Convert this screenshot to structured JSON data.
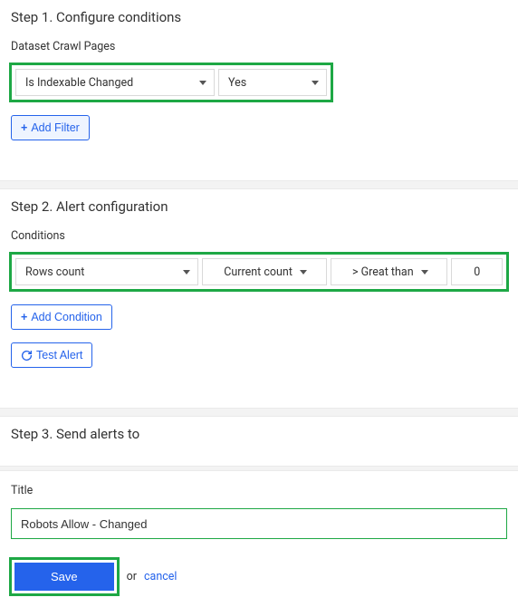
{
  "step1": {
    "title": "Step 1. Configure conditions",
    "dataset_label": "Dataset Crawl Pages",
    "filter_field": "Is Indexable Changed",
    "filter_value": "Yes",
    "add_filter_label": "Add Filter"
  },
  "step2": {
    "title": "Step 2. Alert configuration",
    "conditions_label": "Conditions",
    "metric": "Rows count",
    "scope": "Current count",
    "operator": "> Great than",
    "threshold": "0",
    "add_condition_label": "Add Condition",
    "test_alert_label": "Test Alert"
  },
  "step3": {
    "title": "Step 3. Send alerts to",
    "title_label": "Title",
    "title_value": "Robots Allow - Changed",
    "save_label": "Save",
    "or_text": "or",
    "cancel_label": "cancel"
  }
}
